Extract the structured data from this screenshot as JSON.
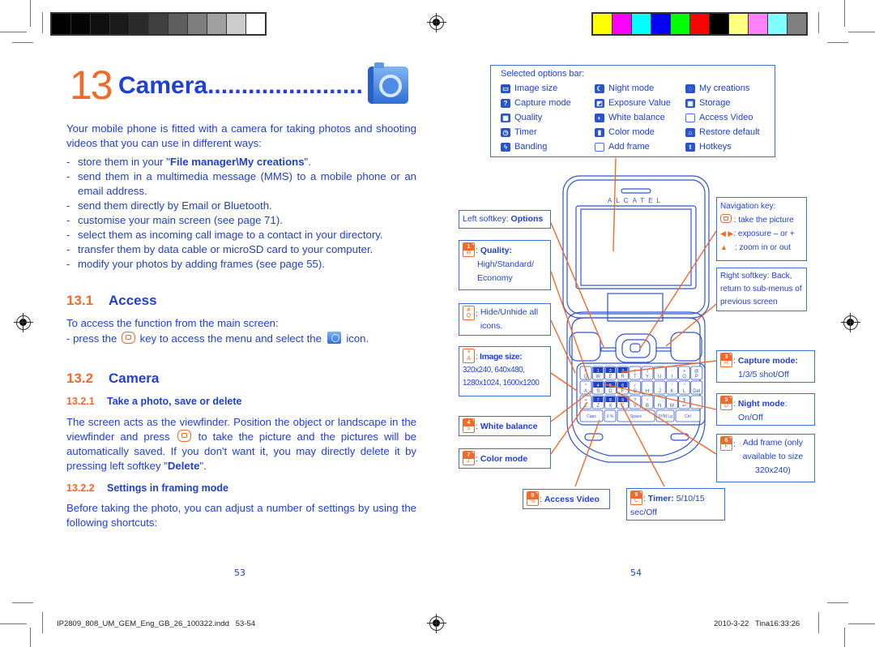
{
  "print_marks": {
    "gray_swatches": [
      "#000000",
      "#050505",
      "#0f0f0f",
      "#1a1a1a",
      "#2a2a2a",
      "#404040",
      "#5e5e5e",
      "#7f7f7f",
      "#a0a0a0",
      "#cccccc",
      "#ffffff"
    ],
    "color_swatches": [
      "#ffff00",
      "#ff00ff",
      "#00ffff",
      "#0000ff",
      "#00ff00",
      "#ff0000",
      "#000000",
      "#ffff80",
      "#ff80ff",
      "#80ffff",
      "#808080"
    ]
  },
  "colors": {
    "text_blue": "#1f3fd6",
    "accent_orange": "#f26a2a"
  },
  "left_page": {
    "chapter_number": "13",
    "chapter_title": "Camera.......................",
    "chapter_icon": "camera-icon",
    "intro": "Your mobile phone is fitted with a camera for taking photos and shooting videos that you can use in different ways:",
    "bullets": [
      {
        "pre": "store them in your \"",
        "bold": "File manager\\My creations",
        "post": "\"."
      },
      {
        "pre": "send them in a multimedia message (MMS) to a mobile phone or an email address.",
        "bold": "",
        "post": ""
      },
      {
        "pre": "send them directly by Email or Bluetooth.",
        "bold": "",
        "post": ""
      },
      {
        "pre": "customise your main screen (see page 71).",
        "bold": "",
        "post": ""
      },
      {
        "pre": "select them as incoming call image to a contact in your directory.",
        "bold": "",
        "post": ""
      },
      {
        "pre": "transfer them by data cable or microSD card to your computer.",
        "bold": "",
        "post": ""
      },
      {
        "pre": "modify your photos by adding frames (see page 55).",
        "bold": "",
        "post": ""
      }
    ],
    "s131": {
      "num": "13.1",
      "title": "Access"
    },
    "access_text": "To access the function from the main screen:",
    "access_bullet": {
      "pre": "press the",
      "mid": "key to access the menu and select the",
      "post": "icon."
    },
    "s132": {
      "num": "13.2",
      "title": "Camera"
    },
    "s1321": {
      "num": "13.2.1",
      "title": "Take a photo, save or delete"
    },
    "take_photo": {
      "pre": "The screen acts as the viewfinder. Position the object or landscape in the viewfinder and press",
      "mid": "to take the picture and the pictures will be automatically saved. If you don't want it, you may directly delete it by pressing left softkey \"",
      "bold": "Delete",
      "post": "\"."
    },
    "s1322": {
      "num": "13.2.2",
      "title": "Settings in framing mode"
    },
    "settings_text": "Before taking the photo, you can adjust a number of settings by using the following shortcuts:",
    "page_number": "53"
  },
  "right_page": {
    "options_bar": {
      "title": "Selected options bar:",
      "columns": [
        [
          {
            "icon": "image-size-icon",
            "glyph": "▭",
            "label": "Image size"
          },
          {
            "icon": "capture-mode-icon",
            "glyph": "?",
            "label": "Capture mode"
          },
          {
            "icon": "quality-icon",
            "glyph": "▦",
            "label": "Quality"
          },
          {
            "icon": "timer-icon",
            "glyph": "◷",
            "label": "Timer"
          },
          {
            "icon": "banding-icon",
            "glyph": "ϟ",
            "label": "Banding"
          }
        ],
        [
          {
            "icon": "night-mode-icon",
            "glyph": "☾",
            "label": "Night mode"
          },
          {
            "icon": "exposure-value-icon",
            "glyph": "◩",
            "label": "Exposure Value"
          },
          {
            "icon": "white-balance-icon",
            "glyph": "◐",
            "label": "White balance"
          },
          {
            "icon": "color-mode-icon",
            "glyph": "▮",
            "label": "Color mode"
          },
          {
            "icon": "add-frame-icon",
            "glyph": "",
            "label": "Add frame"
          }
        ],
        [
          {
            "icon": "my-creations-icon",
            "glyph": "◌",
            "label": "My creations"
          },
          {
            "icon": "storage-icon",
            "glyph": "▣",
            "label": "Storage"
          },
          {
            "icon": "access-video-icon",
            "glyph": "",
            "label": "Access Video"
          },
          {
            "icon": "restore-default-icon",
            "glyph": "⌂",
            "label": "Restore default"
          },
          {
            "icon": "hotkeys-icon",
            "glyph": "t",
            "label": "Hotkeys"
          }
        ]
      ]
    },
    "phone_brand": "ALCATEL",
    "callouts": {
      "left_softkey": {
        "label": "Left softkey: ",
        "value": "Options"
      },
      "quality": {
        "key_top": "1",
        "key_bottom": "W",
        "title": "Quality:",
        "desc": "High/Standard/ Economy"
      },
      "hide": {
        "key_top": "#",
        "key_bottom": "Q",
        "desc": "Hide/Unhide all icons."
      },
      "image_size": {
        "key_top": "*",
        "key_bottom": "A",
        "title": "Image size:",
        "desc": "320x240, 640x480, 1280x1024, 1600x1200"
      },
      "white_balance": {
        "key_top": "4",
        "key_bottom": "S",
        "title": "White balance"
      },
      "color_mode": {
        "key_top": "7",
        "key_bottom": "Z",
        "title": "Color mode"
      },
      "access_video": {
        "key_top": "0",
        "key_bottom": "%",
        "title": "Access Video"
      },
      "timer": {
        "key_top": "9",
        "key_bottom": "C",
        "title": "Timer:",
        "desc": " 5/10/15 sec/Off"
      },
      "navigation": {
        "title": "Navigation key:",
        "items": [
          ": take the picture",
          ": exposure – or +",
          ": zoom in or out"
        ]
      },
      "right_softkey": {
        "desc": "Right softkey: Back, return to sub-menus of previous screen"
      },
      "capture_mode": {
        "key_top": "3",
        "key_bottom": "R",
        "title": "Capture mode:",
        "desc": "1/3/5 shot/Off"
      },
      "night_mode": {
        "key_top": "5",
        "key_bottom": "D",
        "title": "Night mode",
        "desc": "On/Off"
      },
      "add_frame": {
        "key_top": "6",
        "key_bottom": "F",
        "desc": "Add frame (only available to size 320x240)"
      }
    },
    "keyboard": {
      "rows": [
        [
          [
            "#",
            "Q"
          ],
          [
            "1",
            "W"
          ],
          [
            "2",
            "E"
          ],
          [
            "3",
            "R"
          ],
          [
            "(",
            "T"
          ],
          [
            ")",
            "Y"
          ],
          [
            "",
            "U"
          ],
          [
            "-",
            "I"
          ],
          [
            "+",
            "O"
          ],
          [
            "@",
            "P"
          ]
        ],
        [
          [
            "*",
            "A"
          ],
          [
            "4",
            "S"
          ],
          [
            "5",
            "D"
          ],
          [
            "6",
            "F"
          ],
          [
            "/",
            "G"
          ],
          [
            ":",
            "H"
          ],
          [
            ";",
            "J"
          ],
          [
            "'",
            "K"
          ],
          [
            "\"",
            "L"
          ],
          [
            "",
            "Del"
          ]
        ],
        [
          [
            "+",
            "Z"
          ],
          [
            "7",
            "Z"
          ],
          [
            "8",
            "X"
          ],
          [
            "9",
            "C"
          ],
          [
            "?",
            "V"
          ],
          [
            "!",
            "B"
          ],
          [
            ",",
            "N"
          ],
          [
            "",
            "M"
          ],
          [
            "$",
            "↩"
          ],
          [
            "",
            ""
          ]
        ]
      ],
      "bottom": [
        "Caps",
        "0 %",
        "Space",
        "SYM Lg",
        "Ctrl"
      ]
    },
    "page_number": "54"
  },
  "footer": {
    "left": "IP2809_808_UM_GEM_Eng_GB_26_100322.indd   53-54",
    "right": "2010-3-22   Tina16:33:26"
  }
}
